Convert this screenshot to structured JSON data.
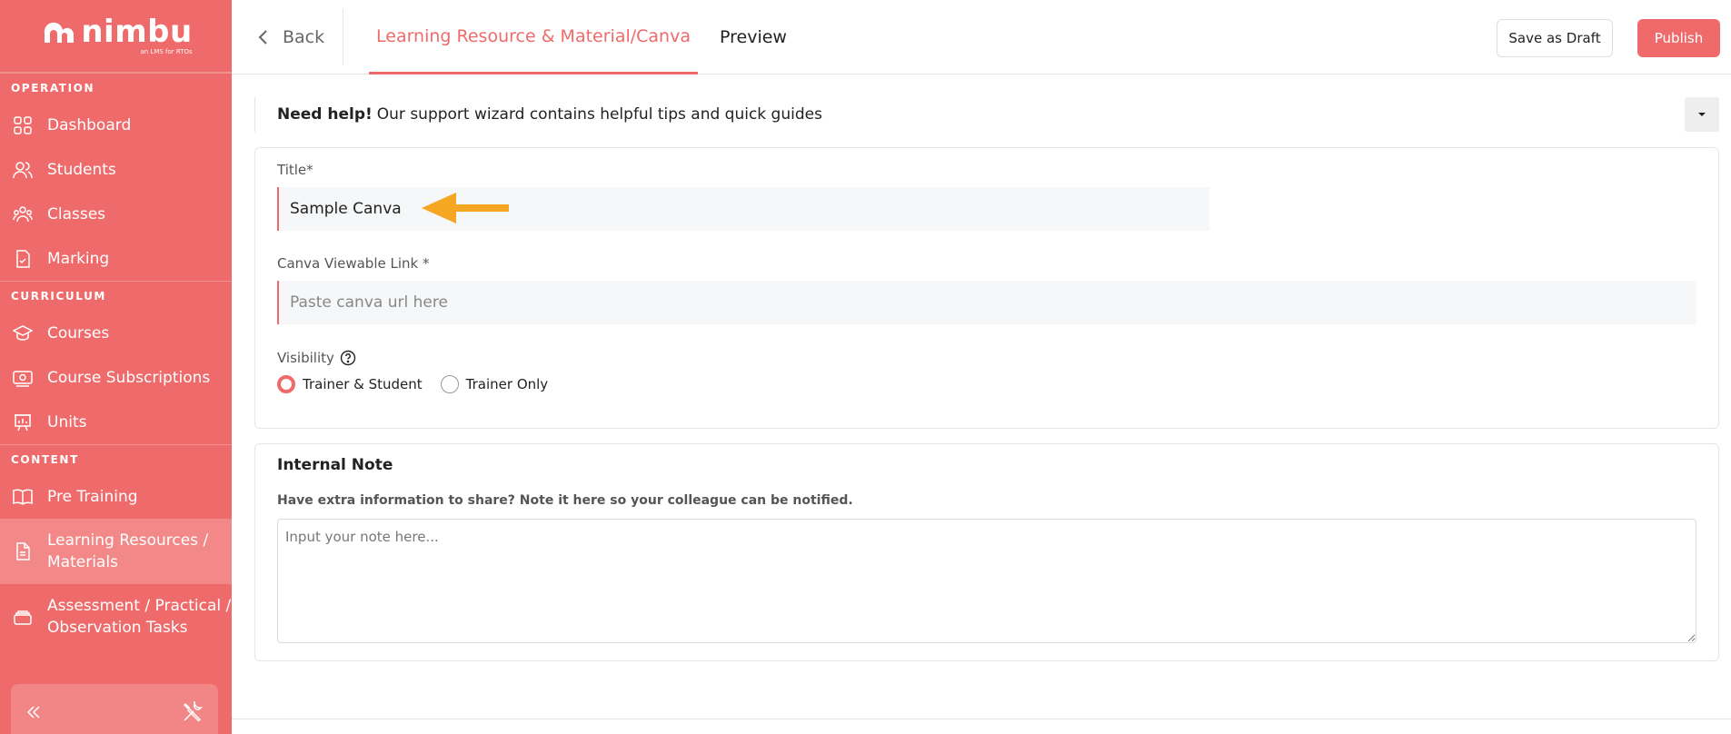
{
  "brand": {
    "name": "nimbu",
    "tagline": "an LMS for RTOs"
  },
  "sidebar": {
    "sections": [
      {
        "label": "OPERATION",
        "items": [
          {
            "label": "Dashboard",
            "icon": "grid-icon"
          },
          {
            "label": "Students",
            "icon": "students-icon"
          },
          {
            "label": "Classes",
            "icon": "classes-icon"
          },
          {
            "label": "Marking",
            "icon": "marking-icon"
          }
        ]
      },
      {
        "label": "CURRICULUM",
        "items": [
          {
            "label": "Courses",
            "icon": "graduation-cap-icon"
          },
          {
            "label": "Course Subscriptions",
            "icon": "subscription-icon"
          },
          {
            "label": "Units",
            "icon": "units-icon"
          }
        ]
      },
      {
        "label": "CONTENT",
        "items": [
          {
            "label": "Pre Training",
            "icon": "book-icon"
          },
          {
            "label": "Learning Resources / Materials",
            "icon": "document-icon",
            "active": true
          },
          {
            "label": "Assessment / Practical / Observation Tasks",
            "icon": "stack-icon"
          }
        ]
      }
    ]
  },
  "topbar": {
    "back_label": "Back",
    "tab_learning": "Learning Resource & Material/Canva",
    "tab_preview": "Preview",
    "save_draft_label": "Save as Draft",
    "publish_label": "Publish"
  },
  "help": {
    "bold": "Need help!",
    "text": "Our support wizard contains helpful tips and quick guides"
  },
  "form": {
    "title_label": "Title*",
    "title_value": "Sample Canva",
    "canva_label": "Canva Viewable Link *",
    "canva_placeholder": "Paste canva url here",
    "visibility_label": "Visibility",
    "visibility_options": [
      "Trainer & Student",
      "Trainer Only"
    ],
    "visibility_selected": "Trainer & Student"
  },
  "note": {
    "title": "Internal Note",
    "subtitle": "Have extra information to share? Note it here so your colleague can be notified.",
    "placeholder": "Input your note here..."
  },
  "colors": {
    "accent": "#ef6b6b",
    "arrow": "#f5a623"
  }
}
